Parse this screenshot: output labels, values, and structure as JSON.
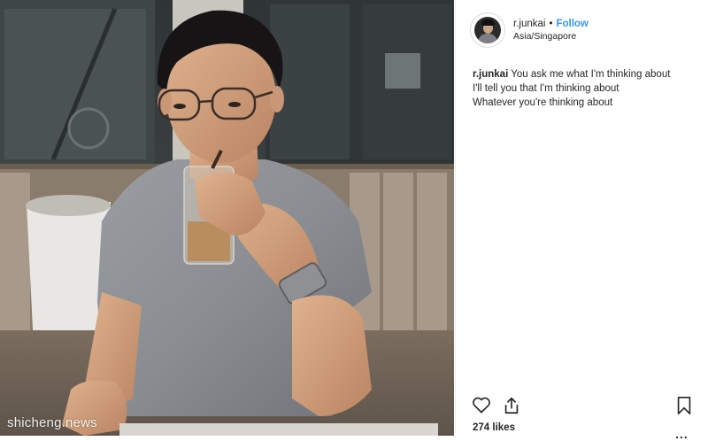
{
  "post": {
    "username": "r.junkai",
    "separator": "•",
    "follow_label": "Follow",
    "location": "Asia/Singapore",
    "caption_user": "r.junkai",
    "caption_lines": [
      "You ask me what I'm thinking about",
      "I'll tell you that I'm thinking about",
      "Whatever you're thinking about"
    ],
    "likes": "274 likes",
    "more_label": "..."
  },
  "watermark": "shicheng.news",
  "icons": {
    "like": "heart-icon",
    "share": "share-icon",
    "save": "bookmark-icon",
    "more": "ellipsis-icon"
  },
  "colors": {
    "link": "#3897f0",
    "text": "#262626"
  }
}
